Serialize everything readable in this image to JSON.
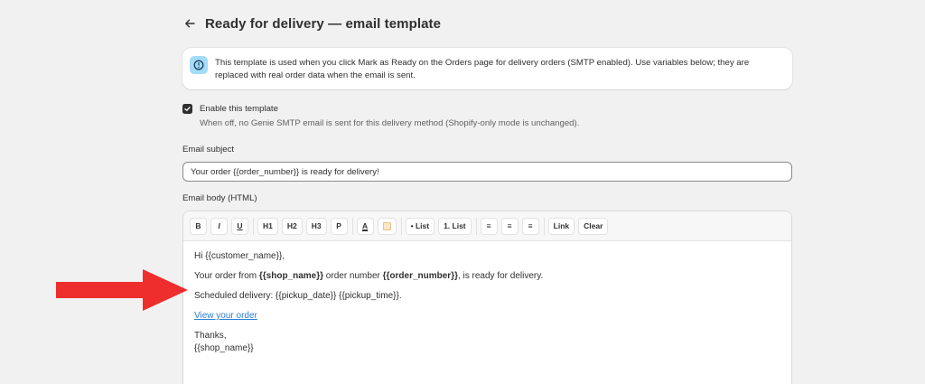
{
  "header": {
    "title": "Ready for delivery — email template"
  },
  "banner": {
    "text": "This template is used when you click Mark as Ready on the Orders page for delivery orders (SMTP enabled). Use variables below; they are replaced with real order data when the email is sent."
  },
  "enable": {
    "label": "Enable this template",
    "help": "When off, no Genie SMTP email is sent for this delivery method (Shopify-only mode is unchanged).",
    "checked": true
  },
  "subject": {
    "label": "Email subject",
    "value": "Your order {{order_number}} is ready for delivery!"
  },
  "body": {
    "label": "Email body (HTML)",
    "toolbar": {
      "bold": "B",
      "italic": "I",
      "underline": "U",
      "h1": "H1",
      "h2": "H2",
      "h3": "H3",
      "paragraph": "P",
      "text_color": "A",
      "bullet_list": "• List",
      "numbered_list": "1. List",
      "align_left": "≡",
      "align_center": "≡",
      "align_right": "≡",
      "link": "Link",
      "clear": "Clear"
    },
    "content": {
      "greeting": "Hi {{customer_name}},",
      "line2_prefix": "Your order from ",
      "line2_shop": "{{shop_name}}",
      "line2_middle": " order number ",
      "line2_order": "{{order_number}}",
      "line2_suffix": ", is ready for delivery.",
      "line3": "Scheduled delivery: {{pickup_date}} {{pickup_time}}.",
      "link_text": "View your order",
      "thanks": "Thanks,",
      "signature": "{{shop_name}}"
    }
  },
  "colors": {
    "accent_arrow": "#ee2d2d",
    "info_badge": "#a4dcf7",
    "link": "#2b7fd6"
  }
}
